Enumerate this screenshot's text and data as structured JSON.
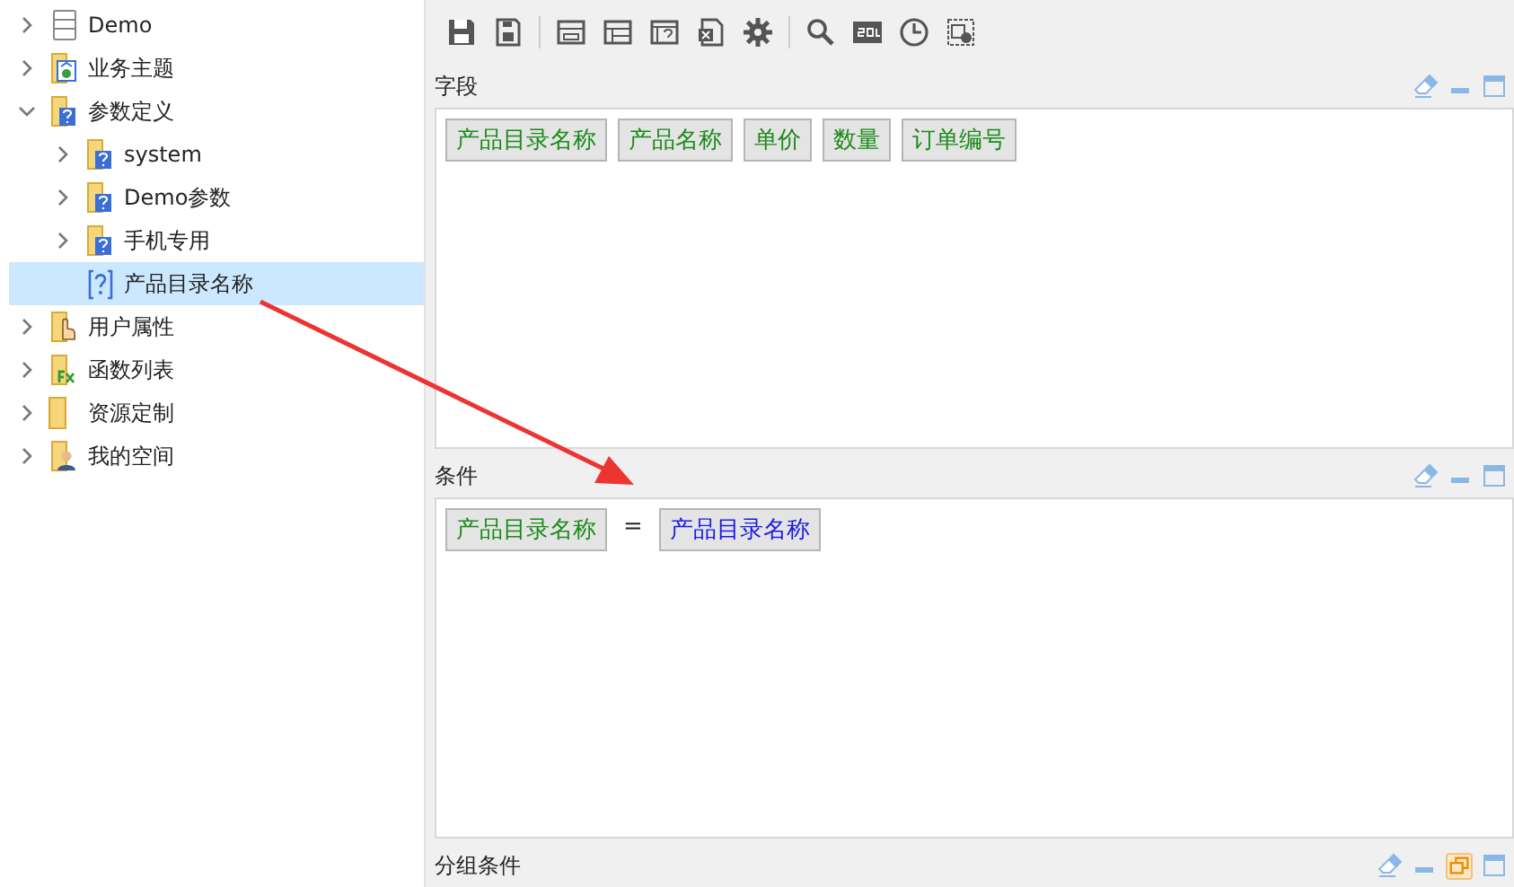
{
  "tree": [
    {
      "label": "Demo",
      "kind": "database",
      "expanded": false,
      "selected": false
    },
    {
      "label": "业务主题",
      "kind": "subject",
      "expanded": false,
      "selected": false
    },
    {
      "label": "参数定义",
      "kind": "paramfolder",
      "expanded": true,
      "selected": false,
      "children": [
        {
          "label": "system",
          "kind": "paramfolder",
          "expanded": false,
          "selected": false
        },
        {
          "label": "Demo参数",
          "kind": "paramfolder",
          "expanded": false,
          "selected": false
        },
        {
          "label": "手机专用",
          "kind": "paramfolder",
          "expanded": false,
          "selected": false
        },
        {
          "label": "产品目录名称",
          "kind": "param",
          "selected": true
        }
      ]
    },
    {
      "label": "用户属性",
      "kind": "handfolder",
      "expanded": false,
      "selected": false
    },
    {
      "label": "函数列表",
      "kind": "functionfolder",
      "expanded": false,
      "selected": false
    },
    {
      "label": "资源定制",
      "kind": "folder",
      "expanded": false,
      "selected": false
    },
    {
      "label": "我的空间",
      "kind": "personfolder",
      "expanded": false,
      "selected": false
    }
  ],
  "panels": [
    {
      "title": "字段",
      "collapsed": false,
      "chips": [
        {
          "text": "产品目录名称",
          "kind": "field"
        },
        {
          "text": "产品名称",
          "kind": "field"
        },
        {
          "text": "单价",
          "kind": "field"
        },
        {
          "text": "数量",
          "kind": "field"
        },
        {
          "text": "订单编号",
          "kind": "field"
        }
      ]
    },
    {
      "title": "条件",
      "collapsed": false,
      "chips": [
        {
          "text": "产品目录名称",
          "kind": "field"
        },
        {
          "text": "=",
          "kind": "operator"
        },
        {
          "text": "产品目录名称",
          "kind": "param"
        }
      ]
    },
    {
      "title": "分组条件",
      "collapsed": true
    }
  ]
}
